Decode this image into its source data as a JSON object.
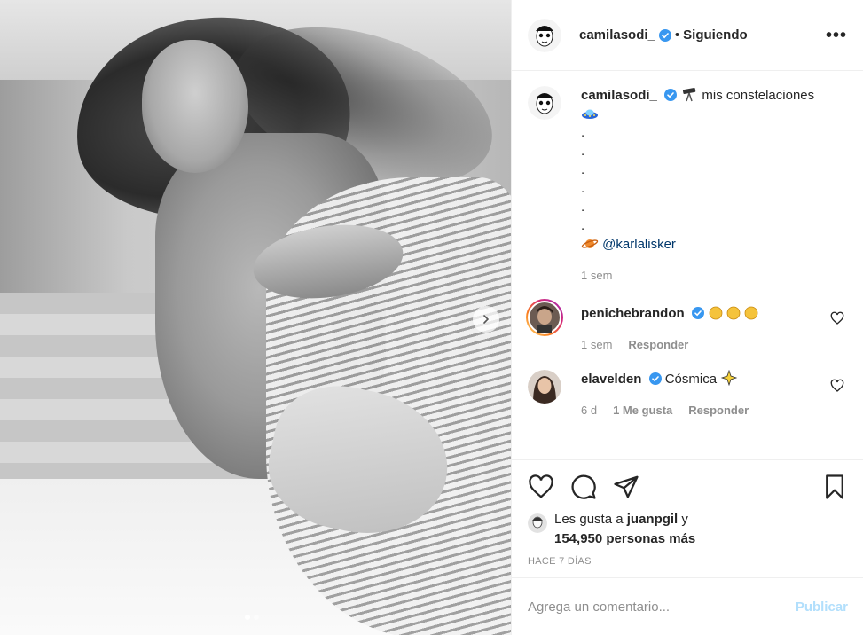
{
  "post_author": {
    "username": "camilasodi_",
    "separator": "•",
    "follow_status": "Siguiendo",
    "more_options": "•••"
  },
  "caption": {
    "username": "camilasodi_",
    "text": "mis constelaciones",
    "dots": [
      ".",
      ".",
      ".",
      ".",
      ".",
      "."
    ],
    "mention": "@karlalisker",
    "time": "1 sem"
  },
  "comments": [
    {
      "username": "penichebrandon",
      "text": "",
      "emoji": "clapping-hands x3",
      "time": "1 sem",
      "reply": "Responder"
    },
    {
      "username": "elavelden",
      "text": "Cósmica",
      "emoji": "sparkles",
      "time": "6 d",
      "likes": "1 Me gusta",
      "reply": "Responder"
    }
  ],
  "likes": {
    "prefix": "Les gusta a",
    "user": "juanpgil",
    "connector": "y",
    "others": "154,950 personas más"
  },
  "post_time": "HACE 7 DÍAS",
  "comment_box": {
    "placeholder": "Agrega un comentario...",
    "publish": "Publicar"
  },
  "carousel": {
    "count": 2,
    "active": 1
  },
  "colors": {
    "verified": "#3897f0",
    "link": "#00376b",
    "publish_disabled": "#b2dffc",
    "secondary_text": "#8e8e8e",
    "story_ring": "#d6249f"
  }
}
